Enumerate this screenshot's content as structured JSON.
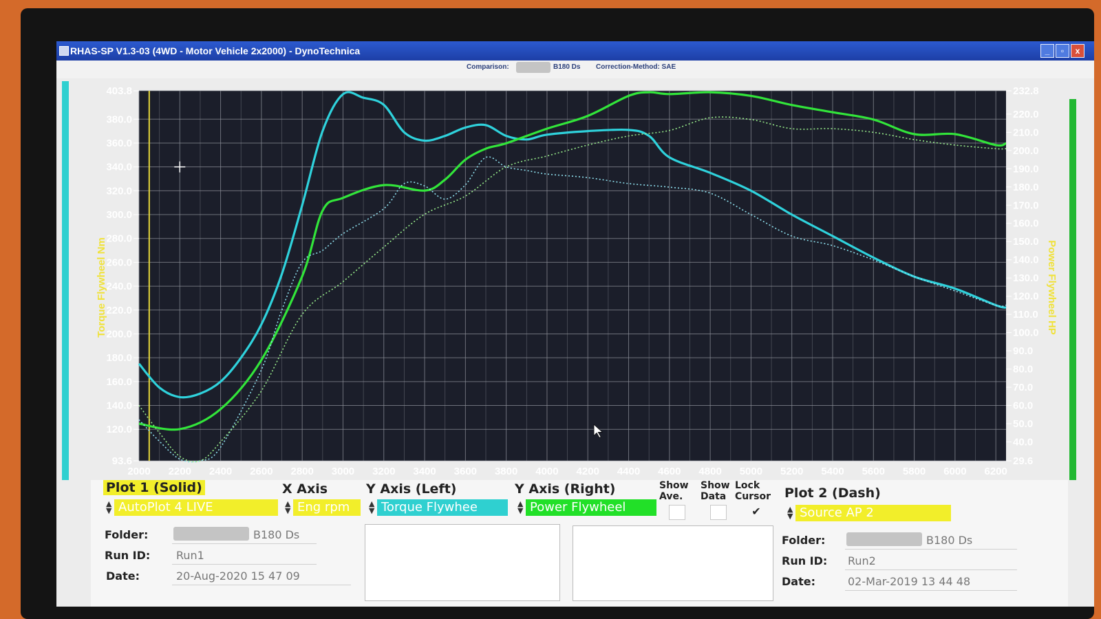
{
  "window": {
    "title": "RHAS-SP V1.3-03  (4WD - Motor Vehicle 2x2000) - DynoTechnica",
    "controls": [
      "_",
      "▫",
      "x"
    ]
  },
  "subheader": {
    "comparison_label": "Comparison:",
    "comparison_value": "B180 Ds",
    "correction_label": "Correction-Method: SAE"
  },
  "chart_data": {
    "type": "line",
    "x_label": "",
    "x_ticks": [
      2000,
      2200,
      2400,
      2600,
      2800,
      3000,
      3200,
      3400,
      3600,
      3800,
      4000,
      4200,
      4400,
      4600,
      4800,
      5000,
      5200,
      5400,
      5600,
      5800,
      6000,
      6200
    ],
    "xlim": [
      2000,
      6250
    ],
    "left_axis": {
      "label": "Torque Flywheel Nm",
      "range": [
        93.6,
        403.8
      ],
      "ticks": [
        "403.8",
        "380.0",
        "360.0",
        "340.0",
        "320.0",
        "300.0",
        "280.0",
        "260.0",
        "240.0",
        "220.0",
        "200.0",
        "180.0",
        "160.0",
        "140.0",
        "120.0",
        "93.6"
      ]
    },
    "right_axis": {
      "label": "Power Flywheel HP",
      "range": [
        29.6,
        232.8
      ],
      "ticks": [
        "232.8",
        "220.0",
        "210.0",
        "200.0",
        "190.0",
        "180.0",
        "170.0",
        "160.0",
        "150.0",
        "140.0",
        "130.0",
        "120.0",
        "110.0",
        "100.0",
        "90.0",
        "80.0",
        "70.0",
        "60.0",
        "50.0",
        "40.0",
        "29.6"
      ]
    },
    "grid": true,
    "series": [
      {
        "name": "Torque Flywheel",
        "color": "#2fd2dc",
        "style": "solid",
        "axis": "left",
        "points": [
          [
            2000,
            175
          ],
          [
            2100,
            155
          ],
          [
            2200,
            147
          ],
          [
            2300,
            150
          ],
          [
            2400,
            160
          ],
          [
            2500,
            180
          ],
          [
            2600,
            208
          ],
          [
            2700,
            250
          ],
          [
            2800,
            308
          ],
          [
            2900,
            370
          ],
          [
            3000,
            401
          ],
          [
            3100,
            398
          ],
          [
            3200,
            392
          ],
          [
            3300,
            369
          ],
          [
            3400,
            362
          ],
          [
            3500,
            366
          ],
          [
            3600,
            373
          ],
          [
            3700,
            375
          ],
          [
            3800,
            366
          ],
          [
            3900,
            363
          ],
          [
            4000,
            367
          ],
          [
            4200,
            370
          ],
          [
            4400,
            371
          ],
          [
            4500,
            366
          ],
          [
            4600,
            348
          ],
          [
            4800,
            335
          ],
          [
            5000,
            320
          ],
          [
            5200,
            300
          ],
          [
            5400,
            282
          ],
          [
            5600,
            264
          ],
          [
            5800,
            248
          ],
          [
            6000,
            238
          ],
          [
            6200,
            224
          ],
          [
            6250,
            222
          ]
        ]
      },
      {
        "name": "Power Flywheel",
        "color": "#32e53a",
        "style": "solid",
        "axis": "right",
        "points": [
          [
            2000,
            50
          ],
          [
            2200,
            47
          ],
          [
            2400,
            58
          ],
          [
            2600,
            85
          ],
          [
            2800,
            131
          ],
          [
            2900,
            167
          ],
          [
            3000,
            174
          ],
          [
            3200,
            181
          ],
          [
            3400,
            178
          ],
          [
            3500,
            184
          ],
          [
            3600,
            195
          ],
          [
            3700,
            201
          ],
          [
            3800,
            204
          ],
          [
            4000,
            212
          ],
          [
            4200,
            219
          ],
          [
            4400,
            230
          ],
          [
            4500,
            232
          ],
          [
            4600,
            231
          ],
          [
            4800,
            232
          ],
          [
            5000,
            230
          ],
          [
            5200,
            225
          ],
          [
            5400,
            221
          ],
          [
            5600,
            217
          ],
          [
            5800,
            209
          ],
          [
            6000,
            209
          ],
          [
            6200,
            203
          ],
          [
            6250,
            204
          ]
        ]
      },
      {
        "name": "Torque Flywheel (Plot 2)",
        "color": "#8fe0ee",
        "style": "dash",
        "axis": "left",
        "points": [
          [
            2000,
            128
          ],
          [
            2100,
            110
          ],
          [
            2200,
            95
          ],
          [
            2300,
            93.6
          ],
          [
            2400,
            105
          ],
          [
            2600,
            170
          ],
          [
            2700,
            220
          ],
          [
            2800,
            260
          ],
          [
            2900,
            270
          ],
          [
            3000,
            284
          ],
          [
            3200,
            305
          ],
          [
            3300,
            326
          ],
          [
            3400,
            324
          ],
          [
            3500,
            313
          ],
          [
            3600,
            325
          ],
          [
            3700,
            348
          ],
          [
            3800,
            340
          ],
          [
            3900,
            337
          ],
          [
            4000,
            334
          ],
          [
            4200,
            331
          ],
          [
            4400,
            326
          ],
          [
            4600,
            323
          ],
          [
            4800,
            318
          ],
          [
            5000,
            300
          ],
          [
            5200,
            282
          ],
          [
            5400,
            274
          ],
          [
            5600,
            262
          ],
          [
            5800,
            248
          ],
          [
            6000,
            236
          ],
          [
            6200,
            224
          ],
          [
            6250,
            224
          ]
        ]
      },
      {
        "name": "Power Flywheel (Plot 2)",
        "color": "#98ec8a",
        "style": "dash",
        "axis": "right",
        "points": [
          [
            2000,
            60
          ],
          [
            2100,
            45
          ],
          [
            2200,
            32
          ],
          [
            2300,
            29.6
          ],
          [
            2400,
            40
          ],
          [
            2600,
            68
          ],
          [
            2800,
            110
          ],
          [
            3000,
            128
          ],
          [
            3200,
            147
          ],
          [
            3400,
            165
          ],
          [
            3600,
            175
          ],
          [
            3800,
            191
          ],
          [
            4000,
            197
          ],
          [
            4200,
            203
          ],
          [
            4400,
            208
          ],
          [
            4600,
            211
          ],
          [
            4800,
            218
          ],
          [
            5000,
            217
          ],
          [
            5200,
            212
          ],
          [
            5400,
            212
          ],
          [
            5600,
            210
          ],
          [
            5800,
            206
          ],
          [
            6000,
            203
          ],
          [
            6200,
            201
          ],
          [
            6250,
            201
          ]
        ]
      }
    ],
    "cursor_x": 2050
  },
  "panel": {
    "plot1_title": "Plot 1 (Solid)",
    "plot1_source": "AutoPlot 4 LIVE",
    "xaxis_title": "X Axis",
    "xaxis_value": "Eng rpm",
    "yleft_title": "Y Axis (Left)",
    "yleft_value": "Torque Flywhee",
    "yright_title": "Y Axis (Right)",
    "yright_value": "Power Flywheel",
    "show_ave_1": "Show",
    "show_ave_2": "Ave.",
    "show_data_1": "Show",
    "show_data_2": "Data",
    "lock_cursor_1": "Lock",
    "lock_cursor_2": "Cursor",
    "lock_checkmark": "✔",
    "plot2_title": "Plot 2 (Dash)",
    "plot2_source": "Source AP 2",
    "folder_label": "Folder:",
    "runid_label": "Run ID:",
    "date_label": "Date:",
    "run1_folder": "B180 Ds",
    "run1_id": "Run1",
    "run1_date": "20-Aug-2020  15 47 09",
    "run2_folder": "B180 Ds",
    "run2_id": "Run2",
    "run2_date": "02-Mar-2019  13 44 48"
  }
}
